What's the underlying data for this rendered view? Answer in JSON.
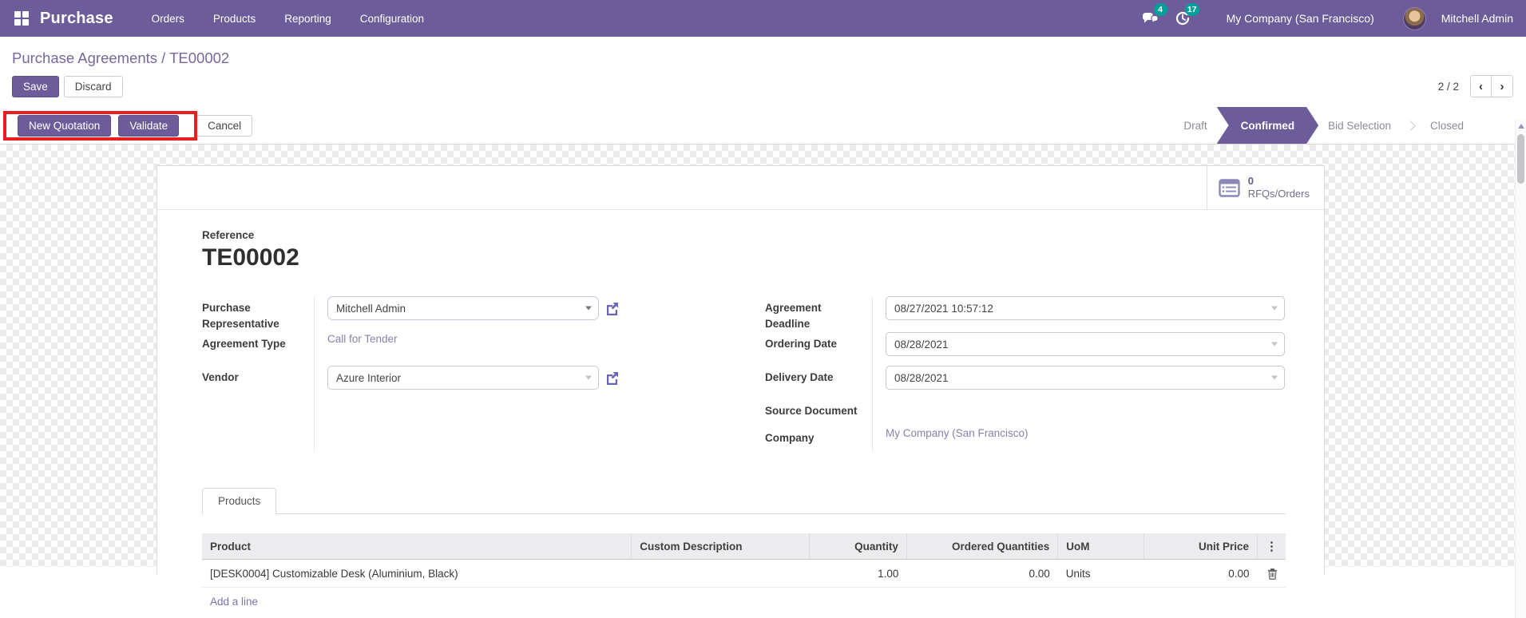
{
  "nav": {
    "app_name": "Purchase",
    "menus": {
      "orders": "Orders",
      "products": "Products",
      "reporting": "Reporting",
      "configuration": "Configuration"
    },
    "messages_badge": "4",
    "activities_badge": "17",
    "company": "My Company (San Francisco)",
    "user": "Mitchell Admin"
  },
  "breadcrumb": "Purchase Agreements / TE00002",
  "control_panel": {
    "save_label": "Save",
    "discard_label": "Discard",
    "pager_text": "2 / 2"
  },
  "statusbar": {
    "new_quotation_label": "New Quotation",
    "validate_label": "Validate",
    "cancel_label": "Cancel",
    "steps": [
      {
        "label": "Draft"
      },
      {
        "label": "Confirmed"
      },
      {
        "label": "Bid Selection"
      },
      {
        "label": "Closed"
      }
    ]
  },
  "sheet": {
    "button_box": {
      "count": "0",
      "label": "RFQs/Orders"
    },
    "reference_label": "Reference",
    "reference_value": "TE00002",
    "fields_left": [
      {
        "label": "Purchase Representative",
        "value": "Mitchell Admin"
      },
      {
        "label": "Agreement Type",
        "value": "Call for Tender"
      },
      {
        "label": "Vendor",
        "value": "Azure Interior"
      }
    ],
    "fields_right": [
      {
        "label": "Agreement Deadline",
        "value": "08/27/2021 10:57:12"
      },
      {
        "label": "Ordering Date",
        "value": "08/28/2021"
      },
      {
        "label": "Delivery Date",
        "value": "08/28/2021"
      },
      {
        "label": "Source Document",
        "value": ""
      },
      {
        "label": "Company",
        "value": "My Company (San Francisco)"
      }
    ],
    "tab_label": "Products",
    "table": {
      "headers": [
        "Product",
        "Custom Description",
        "Quantity",
        "Ordered Quantities",
        "UoM",
        "Unit Price"
      ],
      "rows": [
        {
          "product": "[DESK0004] Customizable Desk (Aluminium, Black)",
          "custom_description": "",
          "quantity": "1.00",
          "ordered_quantities": "0.00",
          "uom": "Units",
          "unit_price": "0.00"
        }
      ],
      "add_line_label": "Add a line"
    }
  },
  "colors": {
    "brand_purple": "#6d5c9a",
    "badge_teal": "#00a09a",
    "annotation_red": "#e8201d",
    "link_purple": "#8a80ab"
  }
}
